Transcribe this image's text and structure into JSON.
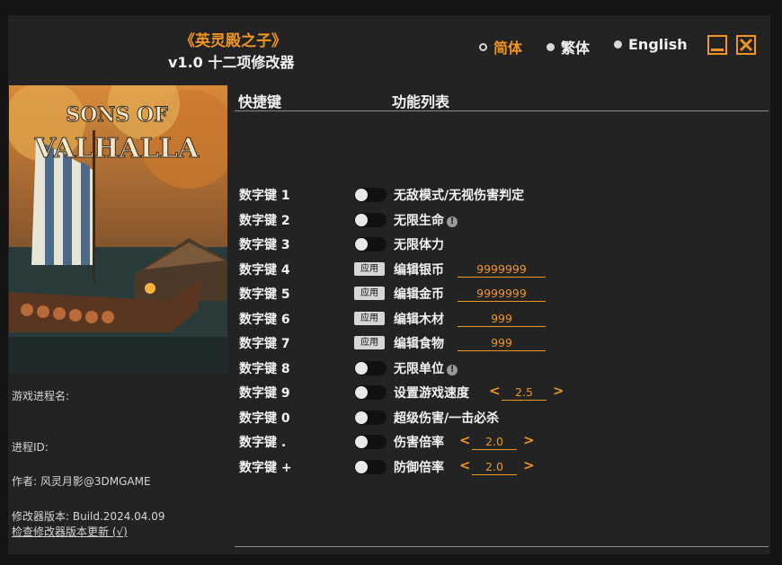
{
  "header": {
    "title": "《英灵殿之子》",
    "subtitle": "v1.0 十二项修改器"
  },
  "languages": [
    {
      "label": "简体",
      "selected": true
    },
    {
      "label": "繁体",
      "selected": false
    },
    {
      "label": "English",
      "selected": false
    }
  ],
  "colors": {
    "accent": "#f0951f",
    "background": "#232323",
    "text": "#f2f2f2"
  },
  "cover": {
    "logo_top": "SONS OF",
    "logo_bottom": "VALHALLA"
  },
  "sidebar": {
    "process_name": "游戏进程名:",
    "process_id": "进程ID:",
    "author": "作者: 风灵月影@3DMGAME",
    "version": "修改器版本: Build.2024.04.09",
    "update_link": "检查修改器版本更新 (√)"
  },
  "columns": {
    "hotkey": "快捷键",
    "functions": "功能列表"
  },
  "apply_label": "应用",
  "cheats": [
    {
      "key": "数字键 1",
      "name": "无敌模式/无视伤害判定",
      "control": "toggle"
    },
    {
      "key": "数字键 2",
      "name": "无限生命",
      "control": "toggle",
      "info": "!"
    },
    {
      "key": "数字键 3",
      "name": "无限体力",
      "control": "toggle"
    },
    {
      "key": "数字键 4",
      "name": "编辑银币",
      "control": "apply",
      "value": "9999999"
    },
    {
      "key": "数字键 5",
      "name": "编辑金币",
      "control": "apply",
      "value": "9999999"
    },
    {
      "key": "数字键 6",
      "name": "编辑木材",
      "control": "apply",
      "value": "999"
    },
    {
      "key": "数字键 7",
      "name": "编辑食物",
      "control": "apply",
      "value": "999"
    },
    {
      "key": "数字键 8",
      "name": "无限单位",
      "control": "toggle",
      "info": "!"
    },
    {
      "key": "数字键 9",
      "name": "设置游戏速度",
      "control": "stepper",
      "value": "2.5"
    },
    {
      "key": "数字键 0",
      "name": "超级伤害/一击必杀",
      "control": "toggle"
    },
    {
      "key": "数字键 .",
      "name": "伤害倍率",
      "control": "stepper",
      "value": "2.0"
    },
    {
      "key": "数字键 +",
      "name": "防御倍率",
      "control": "stepper",
      "value": "2.0"
    }
  ],
  "stepper": {
    "left": "<",
    "right": ">"
  }
}
